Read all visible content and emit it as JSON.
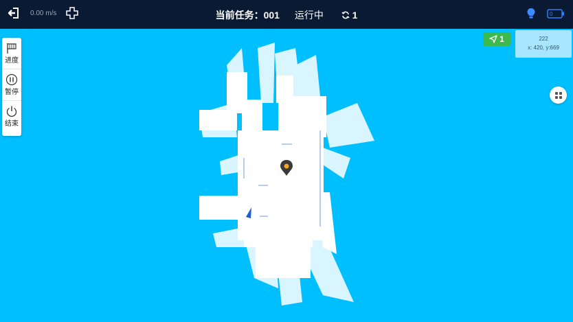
{
  "header": {
    "speed": "0.00 m/s",
    "task_label": "当前任务：001",
    "status": "运行中",
    "loop_count": "1"
  },
  "sidebar": {
    "items": [
      {
        "label": "进度",
        "icon": "flag-icon"
      },
      {
        "label": "暂停",
        "icon": "pause-icon"
      },
      {
        "label": "结束",
        "icon": "power-icon"
      }
    ]
  },
  "map": {
    "nav_badge_count": "1",
    "coord_id": "222",
    "coord_text": "x: 420, y:669"
  },
  "colors": {
    "topbar": "#0B1A33",
    "map_background": "#00BFFF",
    "free_space": "#FFFFFF",
    "nav_badge": "#3DBA4E",
    "coord_box": "#A8E6FF",
    "marker": "#F5A623",
    "battery": "#2F7FFF"
  }
}
